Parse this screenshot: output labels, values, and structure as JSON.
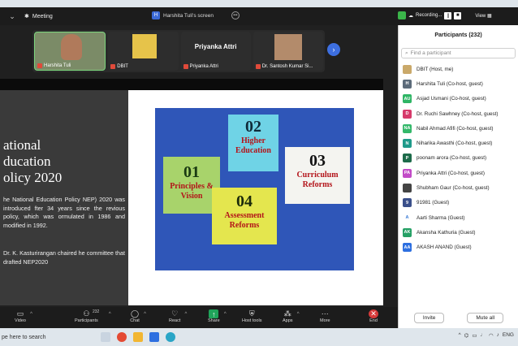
{
  "topbar": {
    "chevron": "⌄",
    "meeting_label": "Meeting",
    "screen_badge": "H",
    "screen_label": "Harshita Tuli's screen",
    "recording_label": "Recording...",
    "view_label": "View"
  },
  "gallery": {
    "tiles": [
      {
        "name": "Harshita Tuli"
      },
      {
        "name": "DBIT"
      },
      {
        "name": "Priyanka Attri",
        "big_label": "Priyanka Attri"
      },
      {
        "name": "Dr. Santosh Kumar Si..."
      }
    ]
  },
  "slide": {
    "title_lines": [
      "ational",
      "ducation",
      "olicy 2020"
    ],
    "paragraph1": "he National Education Policy NEP) 2020 was introduced fter 34 years since the revious policy, which was ormulated in 1986 and modified in 1992.",
    "paragraph2": "Dr. K. Kasturirangan chaired he committee that drafted NEP2020",
    "image_numbers": [
      "01",
      "02",
      "03",
      "04"
    ],
    "image_labels": [
      "Principles & Vision",
      "Higher Education",
      "Curriculum Reforms",
      "Assessment Reforms"
    ]
  },
  "participants": {
    "header": "Participants (232)",
    "search_placeholder": "Find a participant",
    "items": [
      {
        "name": "DBIT (Host, me)",
        "avatar": "",
        "color": "#caa96a"
      },
      {
        "name": "Harshita Tuli (Co-host, guest)",
        "avatar": "H",
        "color": "#5c6b7a"
      },
      {
        "name": "Asjad Usmani (Co-host, guest)",
        "avatar": "AU",
        "color": "#2fb565"
      },
      {
        "name": "Dr. Ruchi Sawhney (Co-host, guest)",
        "avatar": "D",
        "color": "#d63a6b"
      },
      {
        "name": "Nabil Ahmad Afifi (Co-host, guest)",
        "avatar": "NA",
        "color": "#34b86a"
      },
      {
        "name": "Niharika Awasthi (Co-host, guest)",
        "avatar": "N",
        "color": "#1f9a8a"
      },
      {
        "name": "poonam arora (Co-host, guest)",
        "avatar": "P",
        "color": "#1d6b4a"
      },
      {
        "name": "Priyanka Attri (Co-host, guest)",
        "avatar": "PA",
        "color": "#c24bc7"
      },
      {
        "name": "Shubham Gaur (Co-host, guest)",
        "avatar": "",
        "color": "#444444"
      },
      {
        "name": "91981 (Guest)",
        "avatar": "9",
        "color": "#3a4f8a"
      },
      {
        "name": "Aarti Sharma (Guest)",
        "avatar": "A",
        "color": "#ffffff"
      },
      {
        "name": "Akansha Kathuria (Guest)",
        "avatar": "AK",
        "color": "#25a065"
      },
      {
        "name": "AKASH ANAND (Guest)",
        "avatar": "AA",
        "color": "#2d6fe0"
      }
    ],
    "invite_label": "Invite",
    "mute_all_label": "Mute all"
  },
  "toolbar": {
    "video_label": "Video",
    "participants_label": "Participants",
    "participants_count": "232",
    "chat_label": "Chat",
    "react_label": "React",
    "share_label": "Share",
    "host_tools_label": "Host tools",
    "apps_label": "Apps",
    "more_label": "More",
    "end_label": "End"
  },
  "taskbar": {
    "search_text": "pe here to search",
    "language": "ENG"
  }
}
